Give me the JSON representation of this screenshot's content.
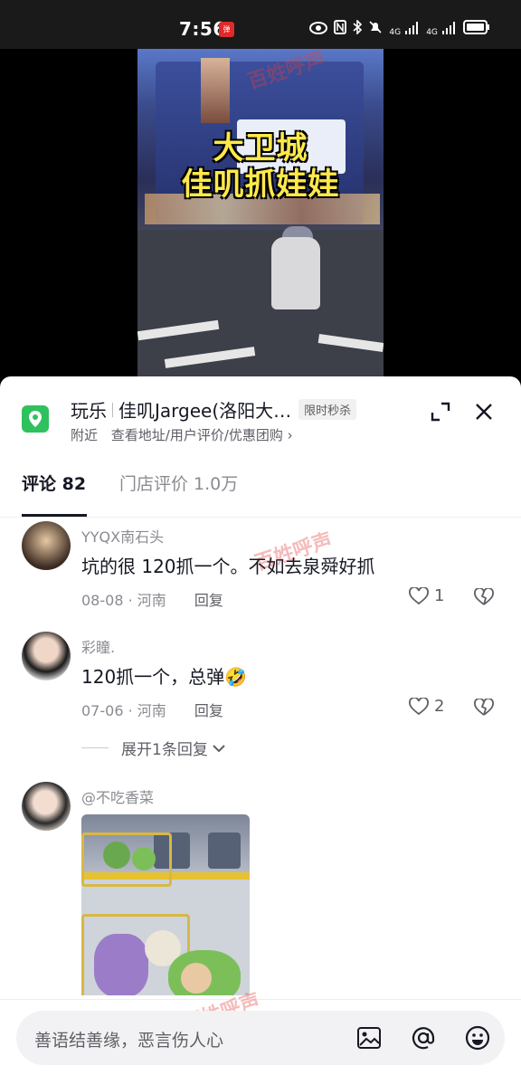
{
  "status_bar": {
    "time": "7:56",
    "badge": "弹",
    "signal_1": "4G",
    "signal_2": "4G"
  },
  "video": {
    "title_line1": "大卫城",
    "title_line2": "佳叽抓娃娃"
  },
  "watermark": "百姓呼声",
  "poi": {
    "category": "玩乐",
    "name": "佳叽Jargee(洛阳大…",
    "tag": "限时秒杀",
    "sub_nearby": "附近",
    "sub_links": "查看地址/用户评价/优惠团购 ›",
    "icons": {
      "expand": "expand-icon",
      "close": "close-icon",
      "location": "location-pin-icon"
    }
  },
  "tabs": [
    {
      "label": "评论 82",
      "active": true
    },
    {
      "label": "门店评价 1.0万",
      "active": false
    }
  ],
  "comments": [
    {
      "user": "YYQX南石头",
      "text": "坑的很 120抓一个。不如去泉舜好抓",
      "date": "08-08",
      "region": "河南",
      "reply_label": "回复",
      "likes": "1"
    },
    {
      "user": "彩瞳.",
      "text": "120抓一个，总弹🤣",
      "date": "07-06",
      "region": "河南",
      "reply_label": "回复",
      "likes": "2",
      "expand_label": "展开1条回复"
    },
    {
      "user": "@不吃香菜",
      "has_image": true
    }
  ],
  "input": {
    "placeholder": "善语结善缘，恶言伤人心"
  },
  "colors": {
    "accent_green": "#2ec15e",
    "title_yellow": "#ffe94a",
    "text_primary": "#161823",
    "text_secondary": "#8a8b91"
  }
}
